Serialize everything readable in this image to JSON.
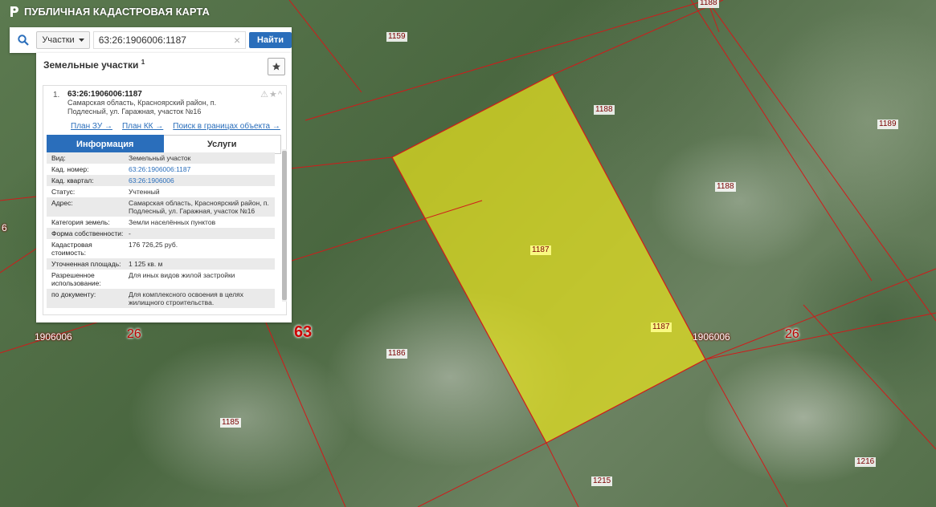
{
  "app": {
    "title": "ПУБЛИЧНАЯ КАДАСТРОВАЯ КАРТА"
  },
  "search": {
    "type_label": "Участки",
    "value": "63:26:1906006:1187",
    "button_label": "Найти",
    "clear_glyph": "×"
  },
  "panel": {
    "title": "Земельные участки",
    "count": "1",
    "result": {
      "index": "1.",
      "number": "63:26:1906006:1187",
      "address": "Самарская область, Красноярский район, п. Подлесный, ул. Гаражная, участок №16",
      "tools": "⚠★^",
      "links": [
        "План ЗУ →",
        "План КК →",
        "Поиск в границах объекта →"
      ],
      "tabs": {
        "info": "Информация",
        "services": "Услуги"
      },
      "rows": [
        {
          "k": "Вид:",
          "v": "Земельный участок"
        },
        {
          "k": "Кад. номер:",
          "v": "63:26:1906006:1187"
        },
        {
          "k": "Кад. квартал:",
          "v": "63:26:1906006"
        },
        {
          "k": "Статус:",
          "v": "Учтенный"
        },
        {
          "k": "Адрес:",
          "v": "Самарская область, Красноярский район, п. Подлесный, ул. Гаражная, участок №16"
        },
        {
          "k": "Категория земель:",
          "v": "Земли населённых пунктов"
        },
        {
          "k": "Форма собственности:",
          "v": "-"
        },
        {
          "k": "Кадастровая стоимость:",
          "v": "176 726,25 руб."
        },
        {
          "k": "Уточненная площадь:",
          "v": "1 125 кв. м"
        },
        {
          "k": "Разрешенное использование:",
          "v": "Для иных видов жилой застройки"
        },
        {
          "k": "по документу:",
          "v": "Для комплексного освоения в целях жилищного строительства."
        }
      ]
    }
  },
  "map": {
    "labels": {
      "p1159": "1159",
      "p1188_top": "1188",
      "p1188_a": "1188",
      "p1188_b": "1188",
      "p1189": "1189",
      "p1187_a": "1187",
      "p1187_b": "1187",
      "p1186": "1186",
      "p1185": "1185",
      "p1215": "1215",
      "p1216": "1216",
      "q_left": "1906006",
      "q_right": "1906006",
      "r_left": "26",
      "r_right": "26",
      "district": "63",
      "edge_left": "6"
    },
    "colors": {
      "boundary": "#d11a1a",
      "selected_fill": "#e6e21e",
      "accent": "#2a6ebb"
    }
  }
}
